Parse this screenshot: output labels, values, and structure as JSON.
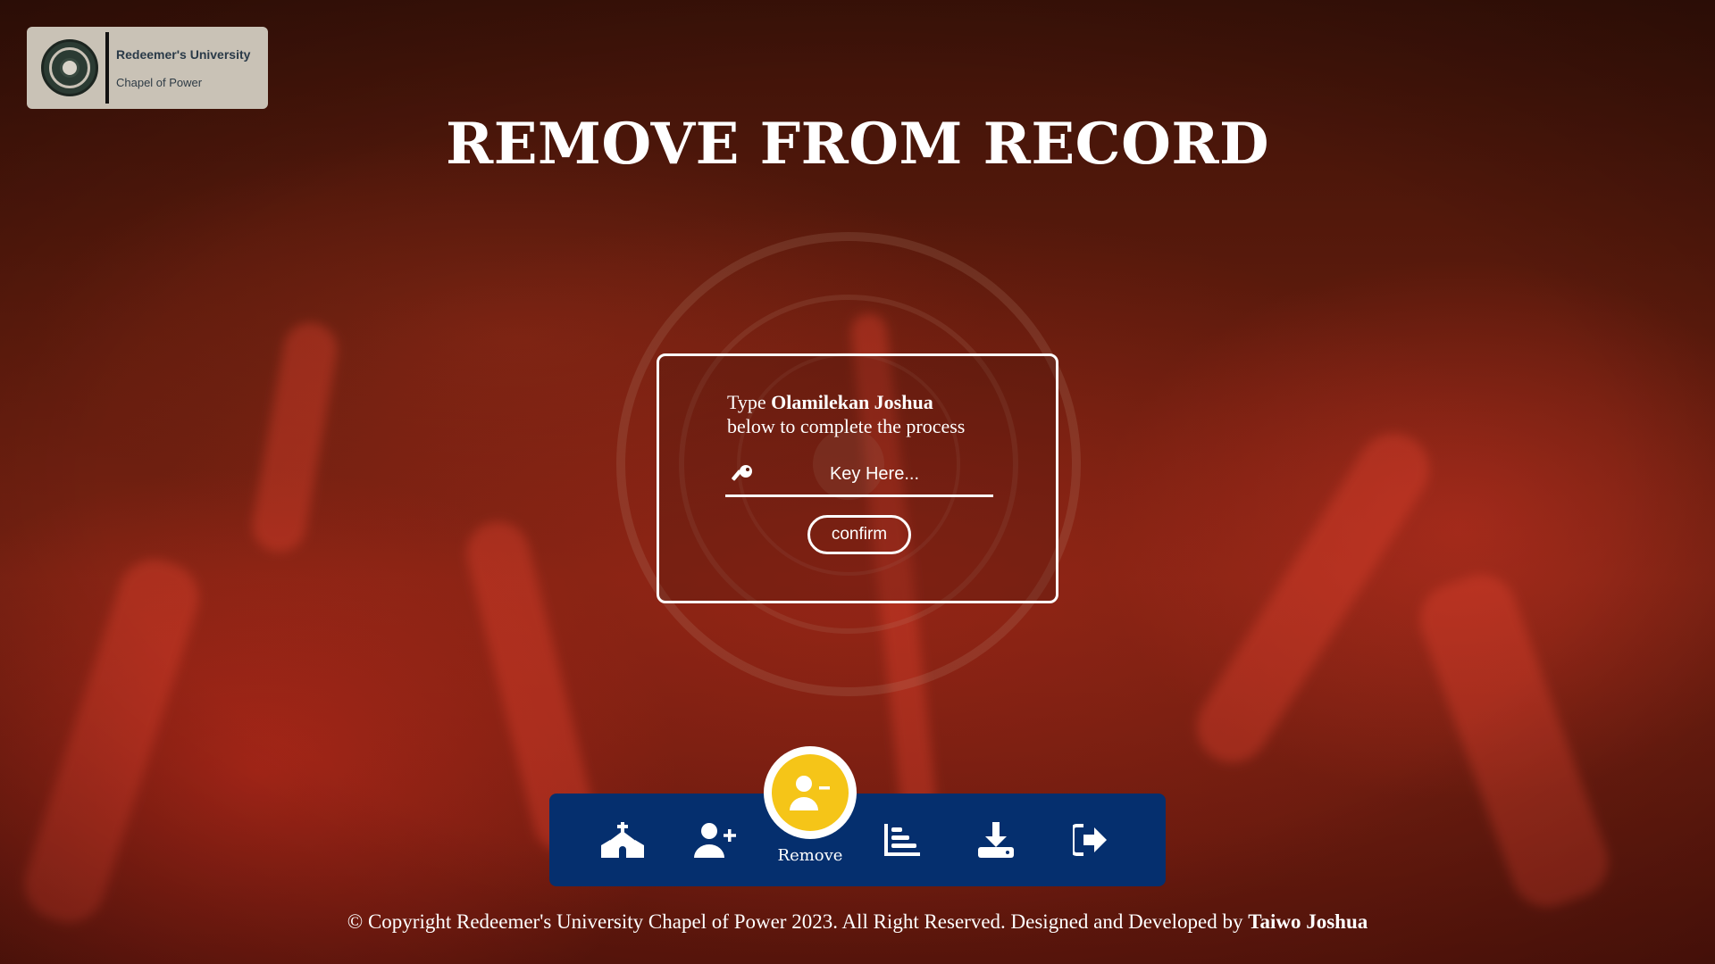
{
  "logo": {
    "name": "Redeemer's University",
    "subtitle": "Chapel of Power"
  },
  "page": {
    "title": "REMOVE FROM RECORD"
  },
  "confirm": {
    "prefix": "Type",
    "member_name": "Olamilekan Joshua",
    "suffix": "below to complete the process",
    "placeholder": "Key Here...",
    "button_label": "confirm"
  },
  "nav": {
    "items": [
      {
        "icon": "church-icon",
        "label": "Home"
      },
      {
        "icon": "user-plus-icon",
        "label": "Add"
      },
      {
        "icon": "user-minus-icon",
        "label": "Remove",
        "active": true
      },
      {
        "icon": "chart-bar-icon",
        "label": "Records"
      },
      {
        "icon": "download-icon",
        "label": "Download"
      },
      {
        "icon": "logout-icon",
        "label": "Logout"
      }
    ],
    "active_label": "Remove"
  },
  "footer": {
    "text": "© Copyright Redeemer's University Chapel of Power 2023. All Right Reserved. Designed and Developed by",
    "developer": "Taiwo Joshua"
  },
  "colors": {
    "nav_background": "#052f6e",
    "active_accent": "#f5c518",
    "text": "#ffffff"
  }
}
